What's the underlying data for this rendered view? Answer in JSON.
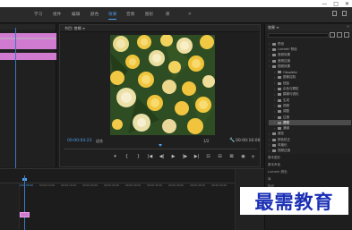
{
  "window": {
    "controls": [
      "—",
      "□",
      "✕"
    ]
  },
  "menu": {
    "items": [
      "学习",
      "组件",
      "编辑",
      "颜色",
      "效果",
      "音频",
      "图形",
      "库"
    ],
    "active_index": 4,
    "more": "»"
  },
  "program_monitor": {
    "title": "节目: 剪辑 ≡",
    "menu_icon": "≡",
    "timecode_current": "00:00:04:23",
    "fit_label": "适合",
    "quality_label": "1/2",
    "timecode_total": "00:00:16:00"
  },
  "transport": {
    "buttons": [
      "▾",
      "{",
      "}",
      "|◀",
      "◀|",
      "▶",
      "|▶",
      "▶|",
      "⊡",
      "⊟",
      "⊠",
      "◉"
    ],
    "add_label": "+"
  },
  "effects_panel": {
    "title": "效果 ≡",
    "menu_icon": "»",
    "items": [
      {
        "label": "预设",
        "depth": 0
      },
      {
        "label": "Lumetri 预设",
        "depth": 0
      },
      {
        "label": "音频效果",
        "depth": 0
      },
      {
        "label": "音频过渡",
        "depth": 0
      },
      {
        "label": "视频效果",
        "depth": 0
      },
      {
        "label": "Obsolete",
        "depth": 1
      },
      {
        "label": "图像控制",
        "depth": 1
      },
      {
        "label": "扭曲",
        "depth": 1
      },
      {
        "label": "杂色与颗粒",
        "depth": 1
      },
      {
        "label": "模糊与锐化",
        "depth": 1
      },
      {
        "label": "生成",
        "depth": 1
      },
      {
        "label": "视频",
        "depth": 1
      },
      {
        "label": "调整",
        "depth": 1
      },
      {
        "label": "过渡",
        "depth": 1
      },
      {
        "label": "透视",
        "depth": 1,
        "selected": true
      },
      {
        "label": "通道",
        "depth": 1
      },
      {
        "label": "键控",
        "depth": 0
      },
      {
        "label": "颜色校正",
        "depth": 0
      },
      {
        "label": "风格化",
        "depth": 0
      },
      {
        "label": "视频过渡",
        "depth": 0
      },
      {
        "label": "预设效果",
        "depth": 0
      }
    ]
  },
  "lower_panels": {
    "items": [
      "基本图形",
      "基本声音",
      "Lumetri 颜色",
      "库",
      "标记",
      "历史记录",
      "信息"
    ]
  },
  "timeline": {
    "timecodes": [
      "00:00",
      "00:00:05:00",
      "00:00:10:00",
      "00:00:15:00",
      "00:00:20:00",
      "00:00:25:00",
      "00:00:30:00",
      "00:00:35:00",
      "00:00:40:00",
      "00:00:45:00",
      "00:00:50:00"
    ],
    "active_index": 1
  },
  "watermark": {
    "text": "最需教育"
  },
  "colors": {
    "accent": "#4ea2f0",
    "clip": "#d07ad0",
    "watermark_text": "#1a2fb5"
  }
}
